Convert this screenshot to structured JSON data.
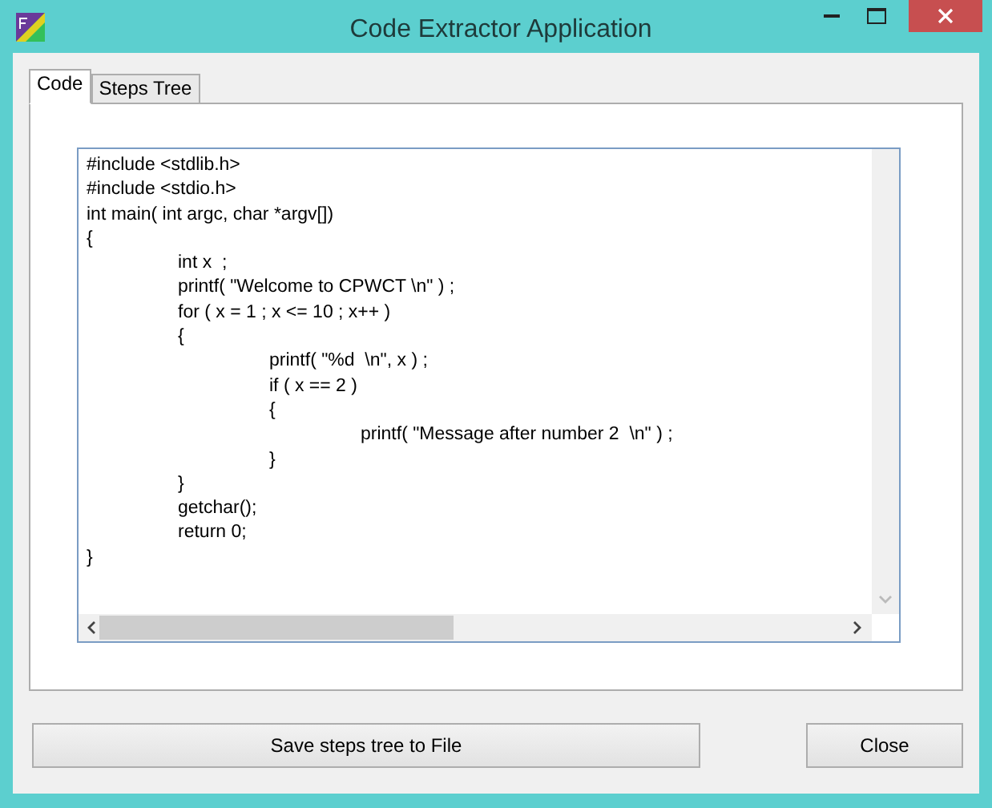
{
  "window": {
    "title": "Code Extractor Application"
  },
  "tabs": [
    {
      "label": "Code",
      "selected": true
    },
    {
      "label": "Steps Tree",
      "selected": false
    }
  ],
  "code_lines": [
    "#include <stdlib.h>",
    "#include <stdio.h>",
    "int main( int argc, char *argv[])",
    "{",
    "\tint x  ;",
    "\tprintf( \"Welcome to CPWCT \\n\" ) ;",
    "\tfor ( x = 1 ; x <= 10 ; x++ )",
    "\t{",
    "\t\tprintf( \"%d  \\n\", x ) ;",
    "\t\tif ( x == 2 )",
    "\t\t{",
    "\t\t\tprintf( \"Message after number 2  \\n\" ) ;",
    "\t\t}",
    "\t}",
    "\tgetchar();",
    "\treturn 0;",
    "}"
  ],
  "buttons": [
    {
      "label": "Save steps tree to File",
      "kind": "wide"
    },
    {
      "label": "Close",
      "kind": "narrow"
    }
  ]
}
